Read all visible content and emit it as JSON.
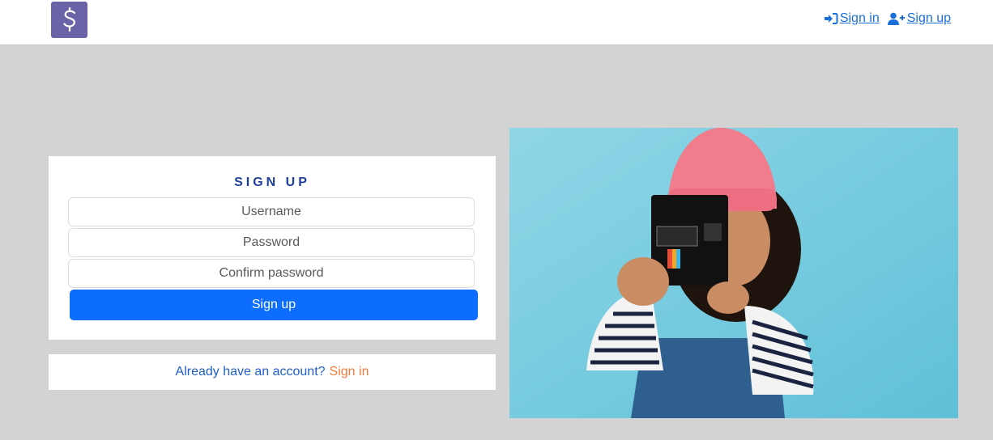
{
  "navbar": {
    "logo_icon": "dollar-sign-icon",
    "sign_in_label": "Sign in",
    "sign_up_label": "Sign up",
    "link_color": "#1a6fd9"
  },
  "form": {
    "title": "SIGN UP",
    "username_placeholder": "Username",
    "password_placeholder": "Password",
    "confirm_placeholder": "Confirm password",
    "submit_label": "Sign up",
    "accent_color": "#0d6efd"
  },
  "switch": {
    "prompt": "Already have an account?",
    "link_label": "Sign in",
    "link_color": "#f07a3e"
  },
  "hero": {
    "image": "child-with-instant-camera-photo"
  }
}
